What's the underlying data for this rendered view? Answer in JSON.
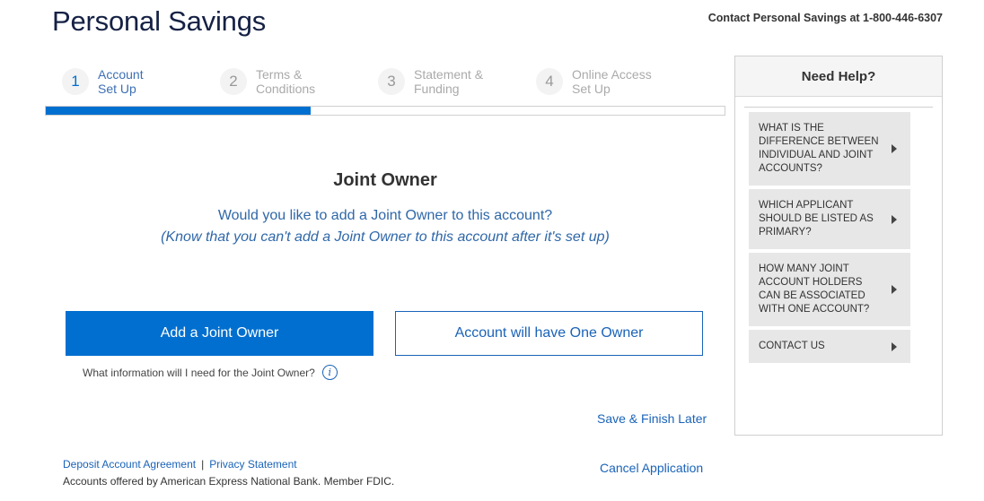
{
  "brand": "Personal Savings",
  "contact": "Contact Personal Savings at 1-800-446-6307",
  "steps": [
    {
      "num": "1",
      "line1": "Account",
      "line2": "Set Up"
    },
    {
      "num": "2",
      "line1": "Terms &",
      "line2": "Conditions"
    },
    {
      "num": "3",
      "line1": "Statement &",
      "line2": "Funding"
    },
    {
      "num": "4",
      "line1": "Online Access",
      "line2": "Set Up"
    }
  ],
  "progress_fraction": 0.39,
  "main": {
    "title": "Joint Owner",
    "question": "Would you like to add a Joint Owner to this account?",
    "note": "(Know that you can't add a Joint Owner to this account after it's set up)",
    "add_button": "Add a Joint Owner",
    "one_owner_button": "Account will have One Owner",
    "info_question": "What information will I need for the Joint Owner?",
    "info_icon": "i",
    "save_link": "Save & Finish Later",
    "cancel_link": "Cancel Application"
  },
  "footer": {
    "agreement_link": "Deposit Account Agreement",
    "separator": "|",
    "privacy_link": "Privacy Statement",
    "disclaimer": "Accounts offered by American Express National Bank. Member FDIC."
  },
  "help": {
    "title": "Need Help?",
    "items": [
      {
        "label": "What is the difference between individual and joint accounts?"
      },
      {
        "label": "Which applicant should be listed as primary?"
      },
      {
        "label": "How many joint account holders can be associated with one account?"
      },
      {
        "label": "Contact us"
      }
    ]
  },
  "colors": {
    "accent": "#006fcf",
    "brand_text": "#152144",
    "link": "#1a63b8"
  }
}
